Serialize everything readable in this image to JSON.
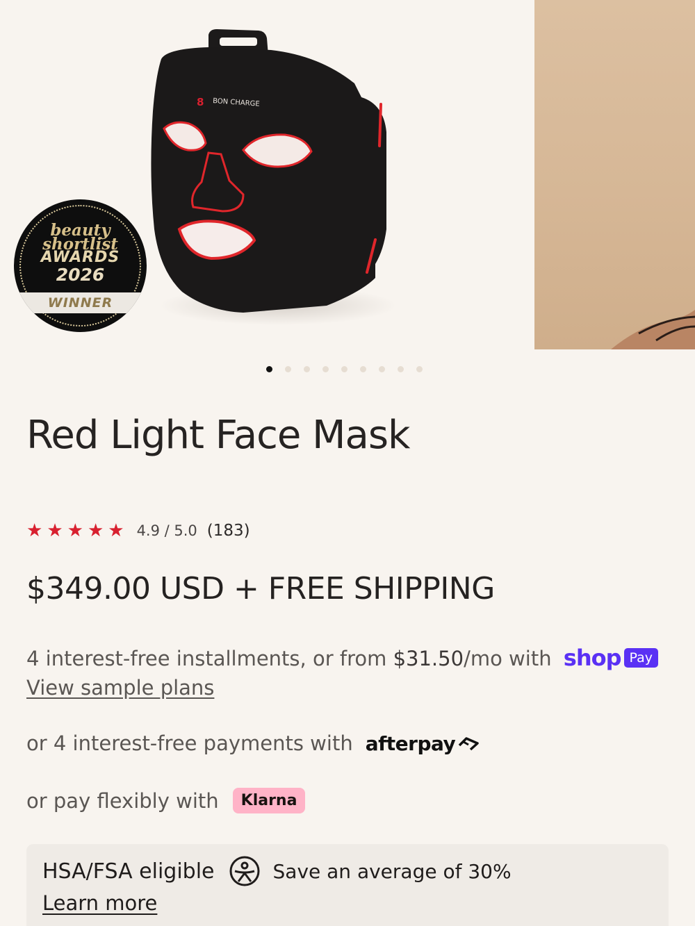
{
  "gallery": {
    "mask_brand_text": "BON CHARGE",
    "badge": {
      "line1": "beauty",
      "line2": "shortlist",
      "line3": "AWARDS",
      "line4": "2026",
      "band": "WINNER"
    },
    "dots_count": 9,
    "active_index": 0
  },
  "product": {
    "title": "Red Light Face Mask",
    "rating": {
      "stars": 5,
      "score_text": "4.9 / 5.0",
      "count_text": "(183)"
    },
    "price_text": "$349.00 USD + FREE SHIPPING"
  },
  "payments": {
    "shop": {
      "prefix": "4 interest-free installments, or from ",
      "amount": "$31.50",
      "suffix": "/mo with",
      "logo": "shop",
      "pay_label": "Pay",
      "link": "View sample plans"
    },
    "afterpay": {
      "text": "or 4 interest-free payments with",
      "logo": "afterpay"
    },
    "klarna": {
      "text": "or pay flexibly with",
      "logo": "Klarna"
    }
  },
  "hsa": {
    "title": "HSA/FSA eligible",
    "save_text": "Save an average of 30%",
    "link": "Learn more"
  },
  "colors": {
    "background": "#f8f4ef",
    "star": "#d8202f",
    "shop_pay": "#5a31f4",
    "klarna_pink": "#ffb3c7",
    "mask_glow": "#e0262b"
  }
}
